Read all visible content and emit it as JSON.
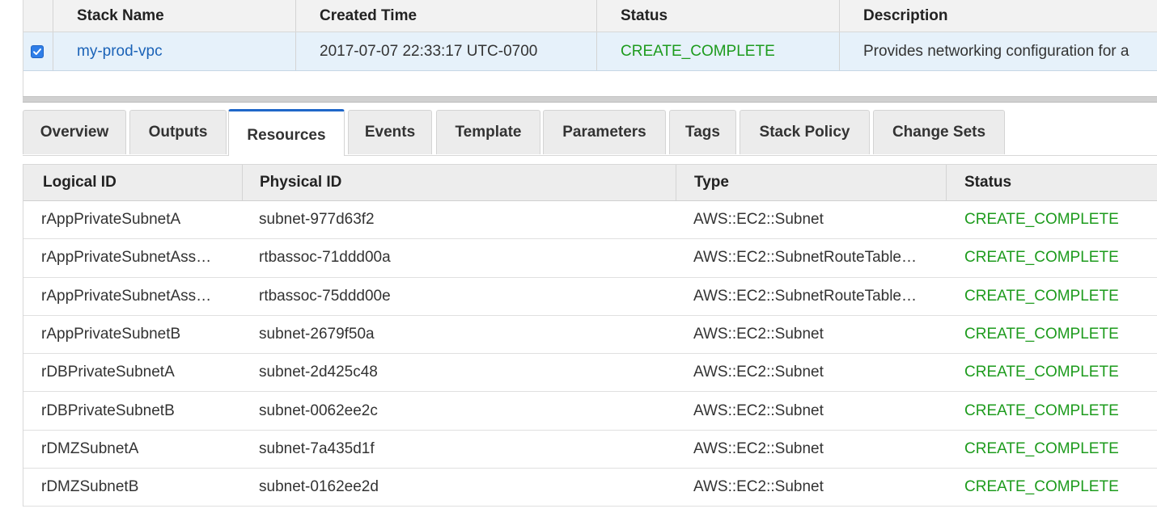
{
  "stacks_table": {
    "columns": [
      "Stack Name",
      "Created Time",
      "Status",
      "Description"
    ],
    "rows": [
      {
        "selected": true,
        "name": "my-prod-vpc",
        "created": "2017-07-07 22:33:17 UTC-0700",
        "status": "CREATE_COMPLETE",
        "description": "Provides networking configuration for a"
      }
    ]
  },
  "tabs": [
    {
      "label": "Overview",
      "active": false
    },
    {
      "label": "Outputs",
      "active": false
    },
    {
      "label": "Resources",
      "active": true
    },
    {
      "label": "Events",
      "active": false
    },
    {
      "label": "Template",
      "active": false
    },
    {
      "label": "Parameters",
      "active": false
    },
    {
      "label": "Tags",
      "active": false
    },
    {
      "label": "Stack Policy",
      "active": false
    },
    {
      "label": "Change Sets",
      "active": false
    }
  ],
  "resources_table": {
    "columns": [
      "Logical ID",
      "Physical ID",
      "Type",
      "Status"
    ],
    "rows": [
      {
        "logical": "rAppPrivateSubnetA",
        "physical": "subnet-977d63f2",
        "type": "AWS::EC2::Subnet",
        "status": "CREATE_COMPLETE"
      },
      {
        "logical": "rAppPrivateSubnetAss…",
        "physical": "rtbassoc-71ddd00a",
        "type": "AWS::EC2::SubnetRouteTable…",
        "status": "CREATE_COMPLETE"
      },
      {
        "logical": "rAppPrivateSubnetAss…",
        "physical": "rtbassoc-75ddd00e",
        "type": "AWS::EC2::SubnetRouteTable…",
        "status": "CREATE_COMPLETE"
      },
      {
        "logical": "rAppPrivateSubnetB",
        "physical": "subnet-2679f50a",
        "type": "AWS::EC2::Subnet",
        "status": "CREATE_COMPLETE"
      },
      {
        "logical": "rDBPrivateSubnetA",
        "physical": "subnet-2d425c48",
        "type": "AWS::EC2::Subnet",
        "status": "CREATE_COMPLETE"
      },
      {
        "logical": "rDBPrivateSubnetB",
        "physical": "subnet-0062ee2c",
        "type": "AWS::EC2::Subnet",
        "status": "CREATE_COMPLETE"
      },
      {
        "logical": "rDMZSubnetA",
        "physical": "subnet-7a435d1f",
        "type": "AWS::EC2::Subnet",
        "status": "CREATE_COMPLETE"
      },
      {
        "logical": "rDMZSubnetB",
        "physical": "subnet-0162ee2d",
        "type": "AWS::EC2::Subnet",
        "status": "CREATE_COMPLETE"
      }
    ]
  },
  "colors": {
    "status_complete": "#1d9b1d",
    "link": "#1a62b7",
    "selected_row": "#e6f1fa",
    "active_tab_accent": "#1f67c9"
  },
  "icons": {
    "row_checkbox": "checkbox-checked-icon"
  }
}
